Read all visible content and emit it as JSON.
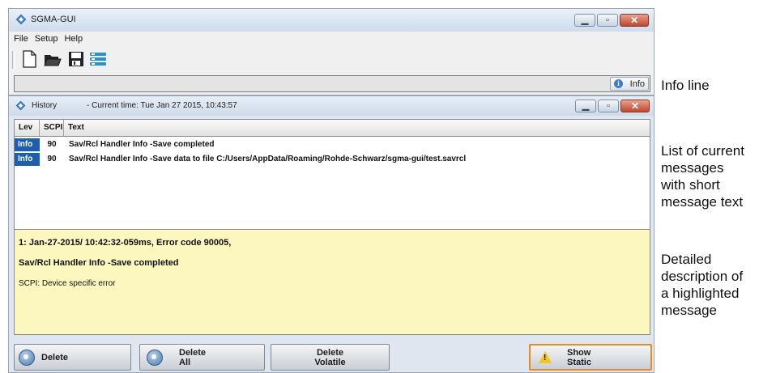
{
  "app": {
    "title": "SGMA-GUI",
    "menu": [
      "File",
      "Setup",
      "Help"
    ],
    "toolbar_icons": [
      "new-document-icon",
      "open-folder-icon",
      "save-icon",
      "settings-list-icon"
    ],
    "info_button": "Info"
  },
  "history": {
    "title": "History",
    "current_time": "- Current time: Tue Jan 27 2015,   10:43:57",
    "columns": [
      "Lev",
      "SCPI",
      "Text"
    ],
    "rows": [
      {
        "lev": "Info",
        "scpi": "90",
        "text": "Sav/Rcl Handler Info -Save completed"
      },
      {
        "lev": "Info",
        "scpi": "90",
        "text": "Sav/Rcl Handler Info -Save data to file C:/Users/AppData/Roaming/Rohde-Schwarz/sgma-gui/test.savrcl"
      }
    ],
    "detail": {
      "line1": "1: Jan-27-2015/ 10:42:32-059ms, Error code 90005,",
      "line2": "Sav/Rcl Handler Info -Save completed",
      "line3": "SCPI: Device specific error"
    },
    "buttons": {
      "delete": "Delete",
      "delete_all_1": "Delete",
      "delete_all_2": "All",
      "delete_volatile_1": "Delete",
      "delete_volatile_2": "Volatile",
      "show_static_1": "Show",
      "show_static_2": "Static"
    }
  },
  "annotations": {
    "info_line": "Info line",
    "list": [
      "List of current",
      "messages",
      "with short",
      "message text"
    ],
    "detail": [
      "Detailed",
      "description of",
      "a highlighted",
      "message"
    ]
  },
  "colors": {
    "accent_blue": "#1d5fae",
    "detail_background": "#fbf7bf",
    "highlight_border": "#e98c19"
  }
}
